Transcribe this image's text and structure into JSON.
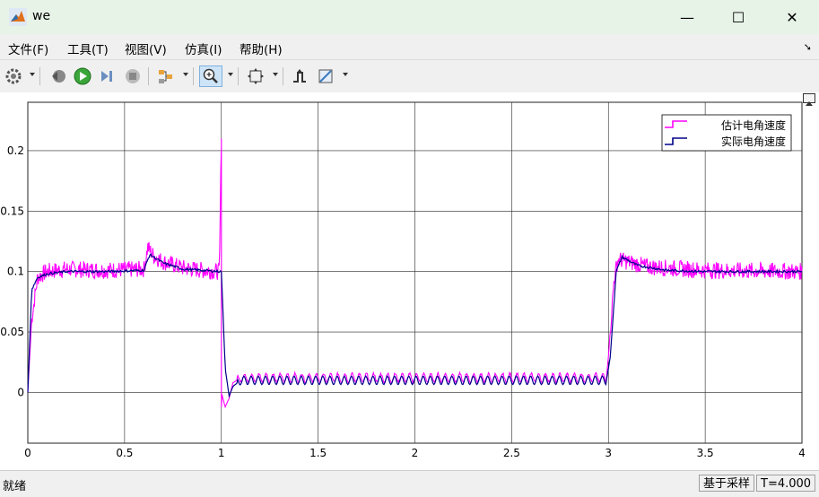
{
  "window": {
    "title": "we",
    "minimize_glyph": "—",
    "maximize_glyph": "☐",
    "close_glyph": "✕"
  },
  "menu": [
    {
      "label": "文件(F)"
    },
    {
      "label": "工具(T)"
    },
    {
      "label": "视图(V)"
    },
    {
      "label": "仿真(I)"
    },
    {
      "label": "帮助(H)"
    }
  ],
  "toolbar": {
    "icons": [
      "gear-icon",
      "step-back-icon",
      "run-icon",
      "step-forward-icon",
      "stop-icon",
      "signal-select-icon",
      "zoom-icon",
      "autoscale-icon",
      "triggers-icon",
      "cursor-measure-icon"
    ]
  },
  "colors": {
    "estimated": "#ff00ff",
    "actual": "#00008b",
    "titlebar": "#e8f3e8"
  },
  "chart_data": {
    "type": "line",
    "title": "",
    "xlabel": "",
    "ylabel": "",
    "xlim": [
      0,
      4
    ],
    "ylim": [
      -0.042,
      0.24
    ],
    "xticks": [
      "0",
      "0.5",
      "1",
      "1.5",
      "2",
      "2.5",
      "3",
      "3.5",
      "4"
    ],
    "yticks": [
      "0",
      "0.05",
      "0.1",
      "0.15",
      "0.2"
    ],
    "grid": true,
    "legend_position": "top-right",
    "series": [
      {
        "name": "估计电角速度",
        "color": "#ff00ff",
        "x": [
          0,
          0.02,
          0.05,
          0.1,
          0.2,
          0.4,
          0.6,
          0.62,
          0.65,
          0.7,
          0.8,
          0.9,
          0.99,
          1.0,
          1.0,
          1.02,
          1.04,
          1.06,
          1.1,
          1.2,
          1.5,
          2.0,
          2.5,
          2.99,
          3.0,
          3.03,
          3.05,
          3.1,
          3.2,
          3.5,
          4.0
        ],
        "y": [
          0,
          0.06,
          0.095,
          0.1,
          0.102,
          0.101,
          0.102,
          0.12,
          0.113,
          0.108,
          0.103,
          0.101,
          0.1,
          0.21,
          0.0,
          -0.012,
          -0.005,
          0.008,
          0.012,
          0.012,
          0.012,
          0.012,
          0.012,
          0.012,
          0.03,
          0.095,
          0.11,
          0.108,
          0.104,
          0.101,
          0.1
        ]
      },
      {
        "name": "实际电角速度",
        "color": "#00008b",
        "x": [
          0,
          0.02,
          0.05,
          0.1,
          0.2,
          0.4,
          0.6,
          0.63,
          0.7,
          0.8,
          0.9,
          1.0,
          1.02,
          1.04,
          1.06,
          1.1,
          1.2,
          1.5,
          2.0,
          2.5,
          2.99,
          3.01,
          3.04,
          3.07,
          3.15,
          3.3,
          3.5,
          4.0
        ],
        "y": [
          0,
          0.085,
          0.095,
          0.098,
          0.1,
          0.1,
          0.101,
          0.114,
          0.107,
          0.102,
          0.101,
          0.1,
          0.02,
          -0.003,
          0.005,
          0.01,
          0.01,
          0.01,
          0.01,
          0.01,
          0.01,
          0.03,
          0.1,
          0.112,
          0.105,
          0.101,
          0.1,
          0.1
        ]
      }
    ]
  },
  "status": {
    "left": "就绪",
    "mode": "基于采样",
    "time": "T=4.000"
  }
}
